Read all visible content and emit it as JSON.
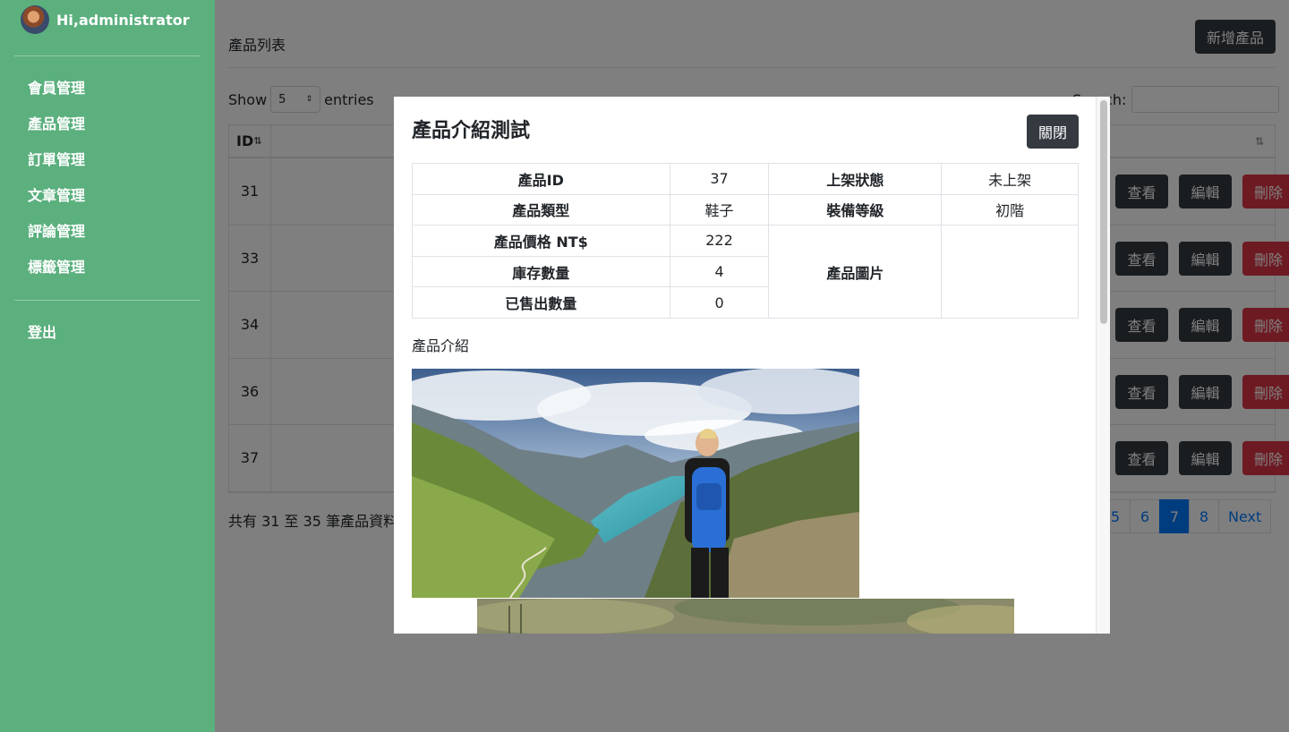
{
  "sidebar": {
    "greeting": "Hi,administrator",
    "items": [
      {
        "label": "會員管理"
      },
      {
        "label": "產品管理"
      },
      {
        "label": "訂單管理"
      },
      {
        "label": "文章管理"
      },
      {
        "label": "評論管理"
      },
      {
        "label": "標籤管理"
      }
    ],
    "logout": "登出"
  },
  "main": {
    "title": "產品列表",
    "add_button": "新增產品",
    "show_label": "Show",
    "entries_label": "entries",
    "page_length": "5",
    "search_label": "Search:",
    "table": {
      "id_header": "ID",
      "rows": [
        {
          "id": "31"
        },
        {
          "id": "33"
        },
        {
          "id": "34"
        },
        {
          "id": "36"
        },
        {
          "id": "37"
        }
      ],
      "view_label": "查看",
      "edit_label": "編輯",
      "delete_label": "刪除"
    },
    "footer_info": "共有 31 至 35 筆產品資料",
    "pagination": {
      "pages": [
        "5",
        "6",
        "7",
        "8"
      ],
      "active": "7",
      "next": "Next"
    }
  },
  "modal": {
    "title": "產品介紹測試",
    "close": "關閉",
    "fields": {
      "id_label": "產品ID",
      "id_value": "37",
      "status_label": "上架狀態",
      "status_value": "未上架",
      "type_label": "產品類型",
      "type_value": "鞋子",
      "level_label": "裝備等級",
      "level_value": "初階",
      "price_label": "產品價格 NT$",
      "price_value": "222",
      "stock_label": "庫存數量",
      "stock_value": "4",
      "image_label": "產品圖片",
      "sold_label": "已售出數量",
      "sold_value": "0"
    },
    "description_label": "產品介紹"
  },
  "colors": {
    "sidebar": "#5bb07e",
    "dark_button": "#343a40",
    "danger": "#dc3545",
    "primary": "#007bff"
  }
}
